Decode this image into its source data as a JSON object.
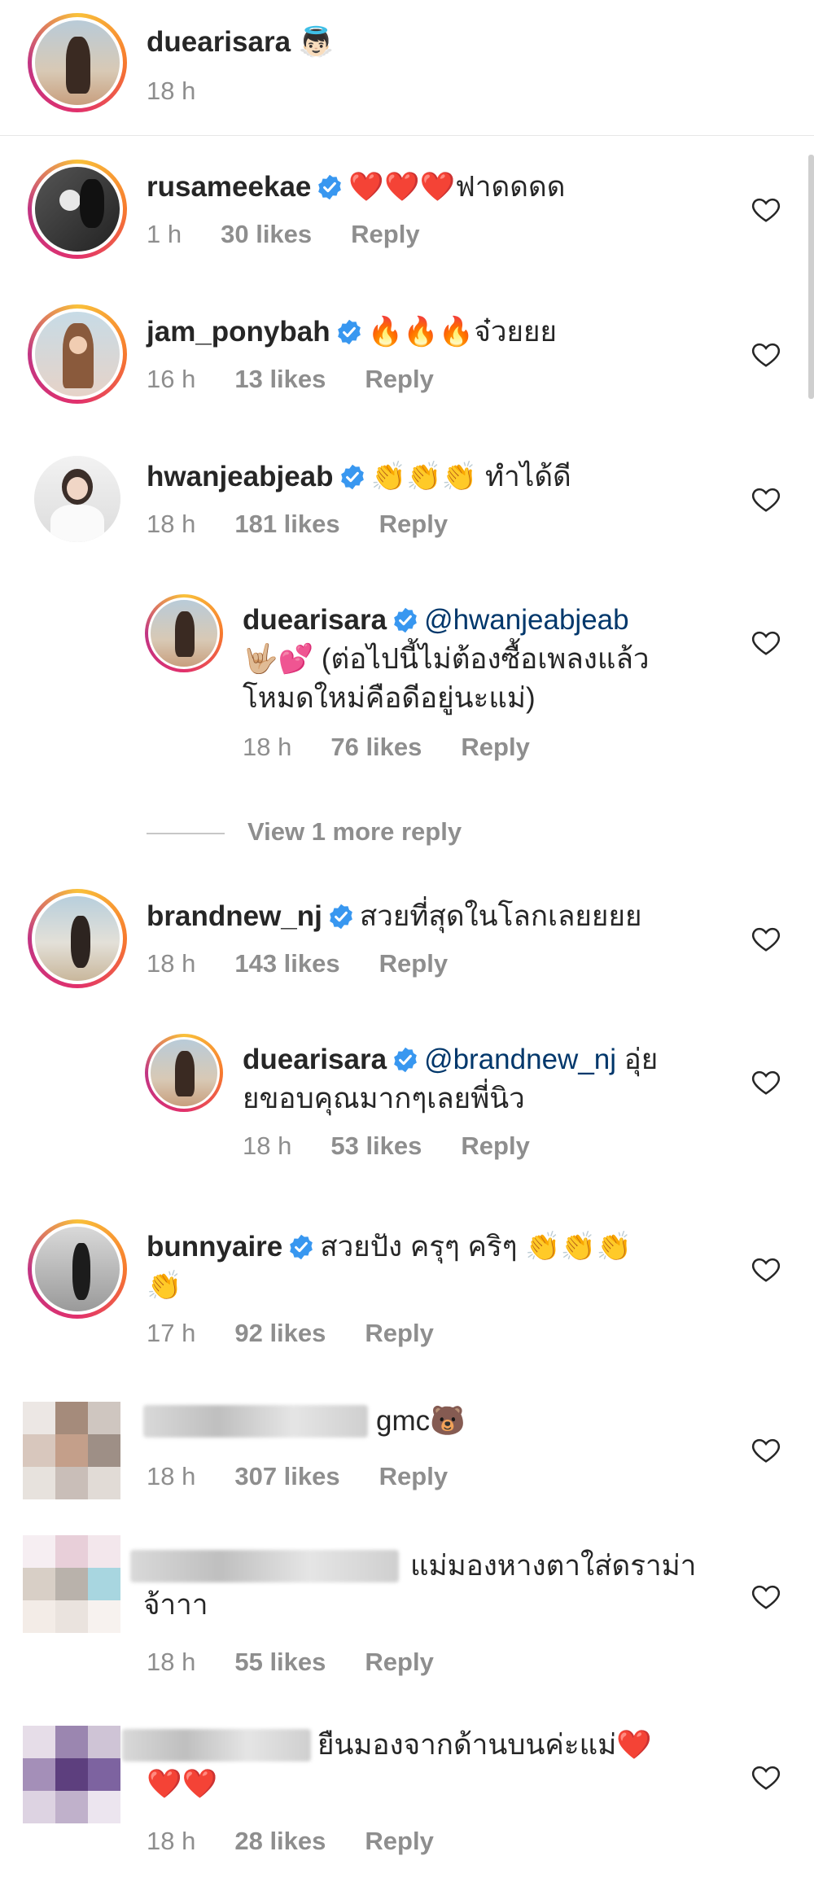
{
  "caption": {
    "username": "duearisara",
    "emoji": "👼🏻",
    "time": "18 h"
  },
  "comments": [
    {
      "username": "rusameekae",
      "text": "❤️❤️❤️ฟาดดดด",
      "time": "1 h",
      "likes": "30 likes",
      "reply": "Reply"
    },
    {
      "username": "jam_ponybah",
      "text": "🔥🔥🔥จ๋วยยย",
      "time": "16 h",
      "likes": "13 likes",
      "reply": "Reply"
    },
    {
      "username": "hwanjeabjeab",
      "text": "👏👏👏 ทำได้ดี",
      "time": "18 h",
      "likes": "181 likes",
      "reply": "Reply"
    },
    {
      "username": "duearisara",
      "mention": "@hwanjeabjeab",
      "line2": "🤟🏼💕 (ต่อไปนี้ไม่ต้องซื้อเพลงแล้ว",
      "line3": "โหมดใหม่คือดีอยู่นะแม่)",
      "time": "18 h",
      "likes": "76 likes",
      "reply": "Reply"
    },
    {
      "username": "brandnew_nj",
      "text": "สวยที่สุดในโลกเลยยยย",
      "time": "18 h",
      "likes": "143 likes",
      "reply": "Reply"
    },
    {
      "username": "duearisara",
      "mention": "@brandnew_nj",
      "text_after": " อุ่ย",
      "line2": "ยขอบคุณมากๆเลยพี่นิว",
      "time": "18 h",
      "likes": "53 likes",
      "reply": "Reply"
    },
    {
      "username": "bunnyaire",
      "text": "สวยปัง ครุๆ คริๆ 👏👏👏",
      "line2": "👏",
      "time": "17 h",
      "likes": "92 likes",
      "reply": "Reply"
    },
    {
      "text": "gmc🐻",
      "time": "18 h",
      "likes": "307 likes",
      "reply": "Reply"
    },
    {
      "text": "แม่มองหางตาใส่ดราม่า",
      "line2": "จ้าาา",
      "time": "18 h",
      "likes": "55 likes",
      "reply": "Reply"
    },
    {
      "text": "ยืนมองจากด้านบนค่ะแม่❤️",
      "line2": "❤️❤️",
      "time": "18 h",
      "likes": "28 likes",
      "reply": "Reply"
    }
  ],
  "view_more": "View 1 more reply",
  "colors": {
    "verified": "#3897f0",
    "meta": "#8e8e8e",
    "text": "#262626"
  }
}
